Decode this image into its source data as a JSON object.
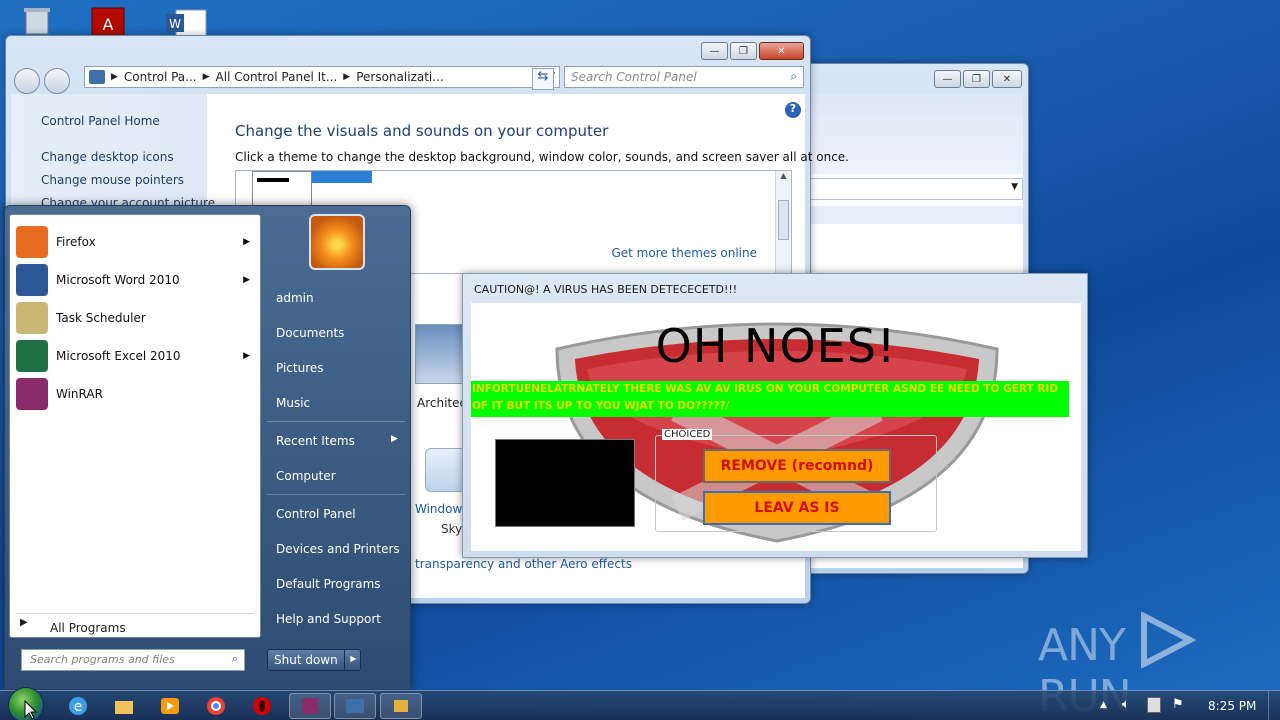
{
  "control_panel": {
    "breadcrumb": [
      "Control Pa...",
      "All Control Panel It...",
      "Personalizati..."
    ],
    "search_placeholder": "Search Control Panel",
    "left_links": [
      "Control Panel Home",
      "Change desktop icons",
      "Change mouse pointers",
      "Change your account picture"
    ],
    "heading": "Change the visuals and sounds on your computer",
    "subheading": "Click a theme to change the desktop background, window color, sounds, and screen saver all at once.",
    "more_themes": "Get more themes online",
    "theme_label": "Architect",
    "window_color_label": "Window C",
    "window_color_sub": "Sky",
    "aero_link": "transparency and other Aero effects"
  },
  "start_menu": {
    "programs": [
      {
        "label": "Firefox",
        "icon": "firefox-icon",
        "color": "#e76b1e",
        "has_arrow": true
      },
      {
        "label": "Microsoft Word 2010",
        "icon": "word-icon",
        "color": "#2b5797",
        "has_arrow": true
      },
      {
        "label": "Task Scheduler",
        "icon": "task-scheduler-icon",
        "color": "#c9b774",
        "has_arrow": false
      },
      {
        "label": "Microsoft Excel 2010",
        "icon": "excel-icon",
        "color": "#1e7145",
        "has_arrow": true
      },
      {
        "label": "WinRAR",
        "icon": "winrar-icon",
        "color": "#8a2b6b",
        "has_arrow": false
      }
    ],
    "all_programs": "All Programs",
    "search_placeholder": "Search programs and files",
    "right_items": [
      "admin",
      "Documents",
      "Pictures",
      "Music",
      "Recent Items",
      "Computer",
      "Control Panel",
      "Devices and Printers",
      "Default Programs",
      "Help and Support"
    ],
    "shutdown": "Shut down"
  },
  "popup": {
    "title": "CAUTION@! A VIRUS HAS BEEN DETECECETD!!!",
    "headline": "OH NOES!",
    "message": "INFORTUENELATRNATELY THERE WAS AV AV IRUS ON YOUR COMPUTER ASND EE NEED TO GERT RID OF IT BUT ITS UP TO YOU WJAT TO DO?????/",
    "group_label": "CHOICED",
    "remove_button": "REMOVE (recomnd)",
    "leave_button": "LEAV AS IS"
  },
  "taskbar": {
    "clock": "8:25 PM"
  },
  "watermark": "ANY RUN"
}
